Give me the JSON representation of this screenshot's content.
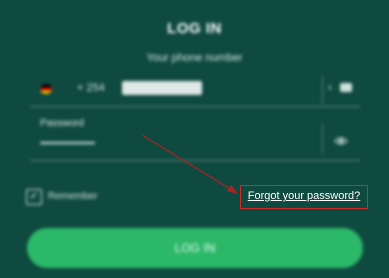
{
  "form": {
    "title": "LOG IN",
    "phone_label": "Your phone number",
    "country_code": "+ 254",
    "password_label": "Password",
    "remember_label": "Remember",
    "forgot_password_link": "Forgot your password?",
    "login_button": "LOG IN"
  },
  "icons": {
    "flag": "flag-icon",
    "keypad": "keypad-icon",
    "back": "back-icon",
    "visibility": "eye-icon",
    "checkbox": "check-icon"
  },
  "colors": {
    "background": "#0f4a41",
    "button": "#2bb868",
    "highlight": "#cf2b2b"
  }
}
